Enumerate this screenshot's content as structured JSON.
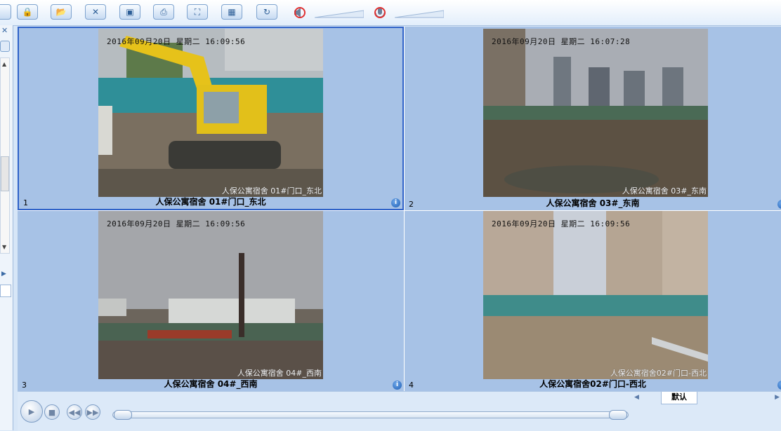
{
  "toolbar": {
    "buttons": [
      {
        "name": "lock-button",
        "icon": "lock-icon",
        "glyph": "🔒"
      },
      {
        "name": "open-folder-button",
        "icon": "folder-icon",
        "glyph": "📂"
      },
      {
        "name": "close-all-button",
        "icon": "close-icon",
        "glyph": "✕"
      },
      {
        "name": "capture-button",
        "icon": "camera-icon",
        "glyph": "▣"
      },
      {
        "name": "print-button",
        "icon": "printer-icon",
        "glyph": "⎙"
      },
      {
        "name": "fullscreen-button",
        "icon": "fullscreen-icon",
        "glyph": "⛶"
      },
      {
        "name": "record-button",
        "icon": "film-icon",
        "glyph": "▦"
      },
      {
        "name": "refresh-button",
        "icon": "refresh-icon",
        "glyph": "↻"
      }
    ],
    "speaker_icon": "speaker-muted-icon",
    "mic_icon": "microphone-muted-icon"
  },
  "channels": [
    {
      "number": "1",
      "caption": "人保公寓宿舍 01#门口_东北",
      "timestamp": "2016年09月20日  星期二  16:09:56",
      "watermark": "人保公寓宿舍 01#门口_东北",
      "selected": true
    },
    {
      "number": "2",
      "caption": "人保公寓宿舍 03#_东南",
      "timestamp": "2016年09月20日  星期二  16:07:28",
      "watermark": "人保公寓宿舍 03#_东南",
      "selected": false
    },
    {
      "number": "3",
      "caption": "人保公寓宿舍 04#_西南",
      "timestamp": "2016年09月20日  星期二  16:09:56",
      "watermark": "人保公寓宿舍 04#_西南",
      "selected": false
    },
    {
      "number": "4",
      "caption": "人保公寓宿舍02#门口-西北",
      "timestamp": "2016年09月20日  星期二  16:09:56",
      "watermark": "人保公寓宿舍02#门口-西北",
      "selected": false
    }
  ],
  "info_glyph": "i",
  "bottom": {
    "tab_label": "默认"
  },
  "colors": {
    "cell_bg": "#a7c2e6",
    "selection": "#2f62c8",
    "toolbar_bg": "#e2eefb"
  }
}
